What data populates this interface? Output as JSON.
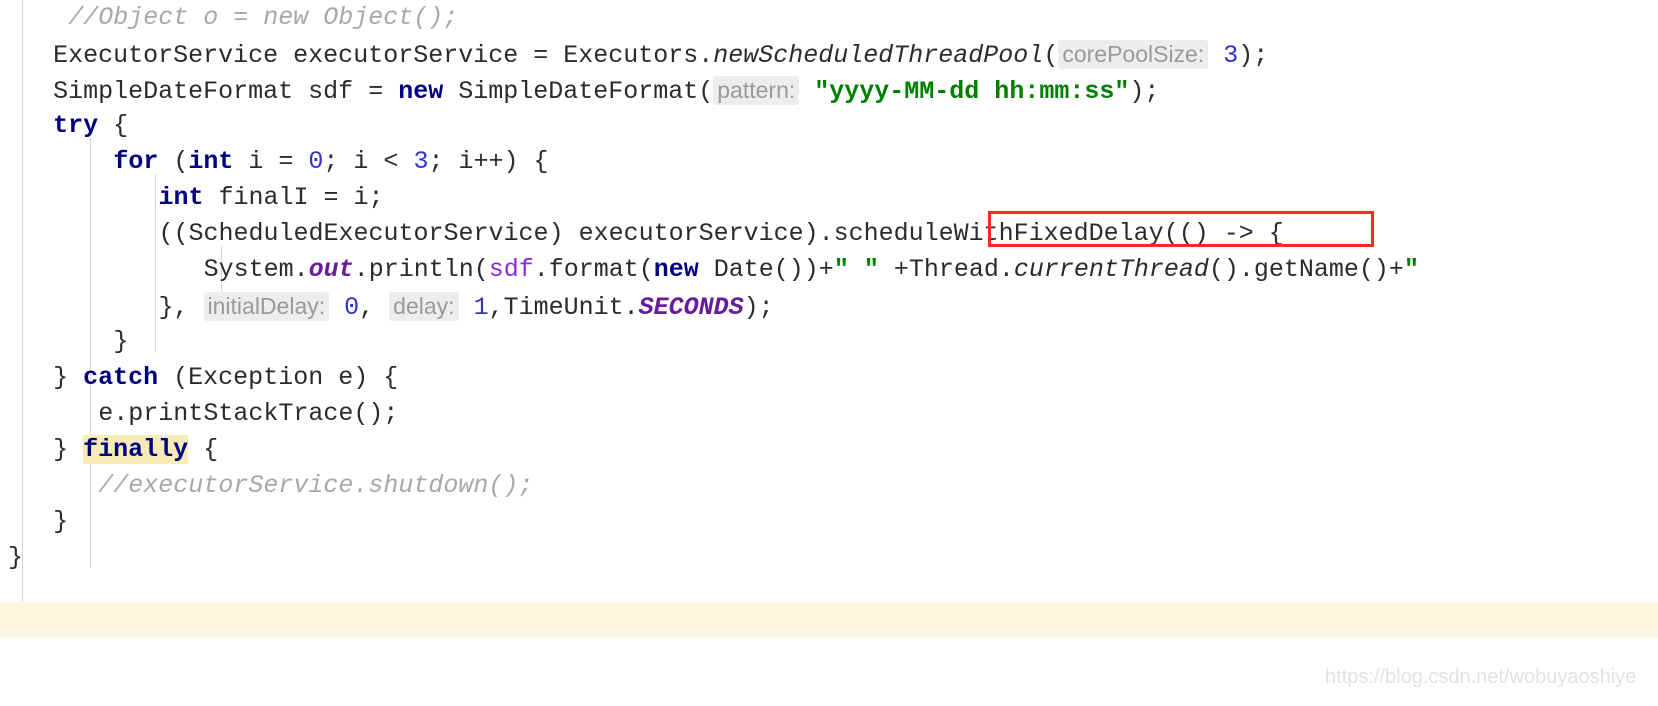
{
  "editor": {
    "language": "java",
    "font_size_px": 25,
    "line_height_px": 36,
    "background": "#ffffff",
    "gutter_line_color": "#d4d4d4",
    "indent_guide_color": "#d8d8d8"
  },
  "colors": {
    "keyword": "#000080",
    "number": "#3333cc",
    "string": "#008000",
    "comment": "#a8a8a8",
    "static_field": "#6a1b9a",
    "field": "#8a2be2",
    "default_text": "#2b2b2b",
    "param_hint_bg": "#ededed",
    "param_hint_fg": "#9a9a9a",
    "search_highlight": "#f7ecb5",
    "annotation_red": "#fa2a23",
    "band_yellow": "#fdf7e2",
    "watermark": "#e2e2e2"
  },
  "lines": [
    {
      "id": "line-comment-object",
      "indent": 4,
      "tokens": [
        {
          "t": "//Object o = new Object();",
          "k": "cmt"
        }
      ]
    },
    {
      "id": "line-executorservice",
      "indent": 3,
      "tokens": [
        {
          "t": "ExecutorService executorService = Executors.",
          "k": "plain"
        },
        {
          "t": "newScheduledThreadPool",
          "k": "mthd"
        },
        {
          "t": "(",
          "k": "plain"
        },
        {
          "t": "corePoolSize:",
          "k": "hint"
        },
        {
          "t": " ",
          "k": "plain"
        },
        {
          "t": "3",
          "k": "num"
        },
        {
          "t": ");",
          "k": "plain"
        }
      ]
    },
    {
      "id": "line-simpledateformat",
      "indent": 3,
      "tokens": [
        {
          "t": "SimpleDateFormat sdf = ",
          "k": "plain"
        },
        {
          "t": "new",
          "k": "kw"
        },
        {
          "t": " SimpleDateFormat(",
          "k": "plain"
        },
        {
          "t": "pattern:",
          "k": "hint"
        },
        {
          "t": " ",
          "k": "plain"
        },
        {
          "t": "\"yyyy-MM-dd hh:mm:ss\"",
          "k": "str"
        },
        {
          "t": ");",
          "k": "plain"
        }
      ]
    },
    {
      "id": "line-try",
      "indent": 3,
      "tokens": [
        {
          "t": "try",
          "k": "kw"
        },
        {
          "t": " {",
          "k": "plain"
        }
      ]
    },
    {
      "id": "line-for",
      "indent": 7,
      "tokens": [
        {
          "t": "for",
          "k": "kw"
        },
        {
          "t": " (",
          "k": "plain"
        },
        {
          "t": "int",
          "k": "kw"
        },
        {
          "t": " i = ",
          "k": "plain"
        },
        {
          "t": "0",
          "k": "num"
        },
        {
          "t": "; i < ",
          "k": "plain"
        },
        {
          "t": "3",
          "k": "num"
        },
        {
          "t": "; i++) {",
          "k": "plain"
        }
      ]
    },
    {
      "id": "line-finali",
      "indent": 10,
      "tokens": [
        {
          "t": "int",
          "k": "kw"
        },
        {
          "t": " finalI = i;",
          "k": "plain"
        }
      ]
    },
    {
      "id": "line-schedulewithfixeddelay",
      "indent": 10,
      "tokens": [
        {
          "t": "((ScheduledExecutorService) executorService).",
          "k": "plain"
        },
        {
          "t": "scheduleWithFixedDelay",
          "k": "plain"
        },
        {
          "t": "(() -> {",
          "k": "plain"
        }
      ]
    },
    {
      "id": "line-println",
      "indent": 13,
      "tokens": [
        {
          "t": "System.",
          "k": "plain"
        },
        {
          "t": "out",
          "k": "static"
        },
        {
          "t": ".println(",
          "k": "plain"
        },
        {
          "t": "sdf",
          "k": "field"
        },
        {
          "t": ".format(",
          "k": "plain"
        },
        {
          "t": "new",
          "k": "kw"
        },
        {
          "t": " Date())+",
          "k": "plain"
        },
        {
          "t": "\" \"",
          "k": "str"
        },
        {
          "t": " +Thread.",
          "k": "plain"
        },
        {
          "t": "currentThread",
          "k": "mthd"
        },
        {
          "t": "().getName()+",
          "k": "plain"
        },
        {
          "t": "\"",
          "k": "str"
        }
      ]
    },
    {
      "id": "line-initialdelay",
      "indent": 10,
      "tokens": [
        {
          "t": "}, ",
          "k": "plain"
        },
        {
          "t": "initialDelay:",
          "k": "hint"
        },
        {
          "t": " ",
          "k": "plain"
        },
        {
          "t": "0",
          "k": "num"
        },
        {
          "t": ", ",
          "k": "plain"
        },
        {
          "t": "delay:",
          "k": "hint"
        },
        {
          "t": " ",
          "k": "plain"
        },
        {
          "t": "1",
          "k": "num"
        },
        {
          "t": ",TimeUnit.",
          "k": "plain"
        },
        {
          "t": "SECONDS",
          "k": "static"
        },
        {
          "t": ");",
          "k": "plain"
        }
      ]
    },
    {
      "id": "line-close-for",
      "indent": 7,
      "tokens": [
        {
          "t": "}",
          "k": "plain"
        }
      ]
    },
    {
      "id": "line-catch",
      "indent": 3,
      "tokens": [
        {
          "t": "} ",
          "k": "plain"
        },
        {
          "t": "catch",
          "k": "kw"
        },
        {
          "t": " (Exception e) {",
          "k": "plain"
        }
      ]
    },
    {
      "id": "line-printstacktrace",
      "indent": 6,
      "tokens": [
        {
          "t": "e.printStackTrace();",
          "k": "plain"
        }
      ]
    },
    {
      "id": "line-finally",
      "indent": 3,
      "tokens": [
        {
          "t": "} ",
          "k": "plain"
        },
        {
          "t": "finally",
          "k": "kw hl-yellow"
        },
        {
          "t": " {",
          "k": "plain"
        }
      ]
    },
    {
      "id": "line-comment-shutdown",
      "indent": 6,
      "tokens": [
        {
          "t": "//executorService.shutdown();",
          "k": "cmt"
        }
      ]
    },
    {
      "id": "line-close-finally",
      "indent": 3,
      "tokens": [
        {
          "t": "}",
          "k": "plain"
        }
      ]
    },
    {
      "id": "line-close-method",
      "indent": 0,
      "tokens": [
        {
          "t": "}",
          "k": "plain"
        }
      ]
    }
  ],
  "annotation": {
    "type": "red-rectangle",
    "target_text": "scheduleWithFixedDelay",
    "color": "#fa2a23"
  },
  "watermark": {
    "text": "https://blog.csdn.net/wobuyaoshiye"
  }
}
